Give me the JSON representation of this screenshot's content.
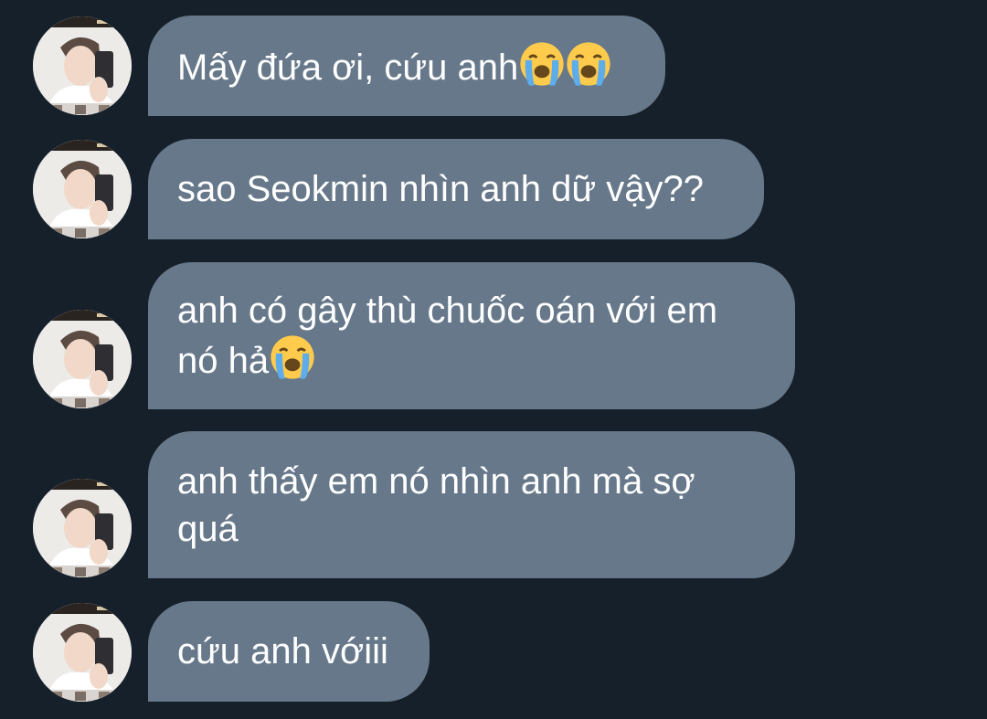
{
  "messages": [
    {
      "text": "Mấy đứa ơi, cứu anh",
      "emoji_count": 2
    },
    {
      "text": "sao Seokmin nhìn anh dữ vậy??",
      "emoji_count": 0
    },
    {
      "text": "anh có gây thù chuốc oán với em nó hả",
      "emoji_count": 1
    },
    {
      "text": "anh thấy em nó nhìn anh mà sợ quá",
      "emoji_count": 0
    },
    {
      "text": "cứu anh vớiii",
      "emoji_count": 0
    }
  ],
  "emoji": "loudly-crying-face-icon",
  "colors": {
    "background": "#16202a",
    "bubble": "#66788a",
    "text": "#ffffff"
  }
}
